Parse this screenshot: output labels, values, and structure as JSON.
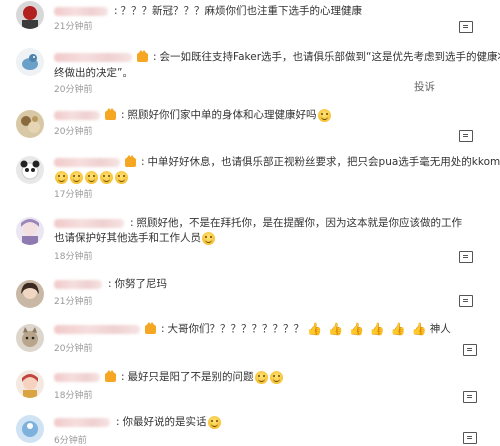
{
  "report_label": "投诉",
  "comments": [
    {
      "name_blur_w": 54,
      "badge": false,
      "text": "？？？新冠？？？麻烦你们也注重下选手的心理健康",
      "time": "21分钟前",
      "avatar": "red"
    },
    {
      "name_blur_w": 78,
      "badge": true,
      "text": "会一如既往支持Faker选手，也请俱乐部做到“这是优先考虑到选手的健康状",
      "text2": "终做出的决定”。",
      "time": "20分钟前",
      "avatar": "bird"
    },
    {
      "name_blur_w": 46,
      "badge": true,
      "text": "照顾好你们家中单的身体和心理健康好吗",
      "time": "20分钟前",
      "avatar": "food"
    },
    {
      "name_blur_w": 66,
      "badge": true,
      "text": "中单好好休息，也请俱乐部正视粉丝要求，把只会pua选手毫无用处的kkoma",
      "text2": "",
      "time": "17分钟前",
      "avatar": "panda"
    },
    {
      "name_blur_w": 70,
      "badge": false,
      "text": "照顾好他，不是在拜托你，是在提醒你，因为这本就是你应该做的工作",
      "text2": "也请保护好其他选手和工作人员",
      "time": "18分钟前",
      "avatar": "anime"
    },
    {
      "name_blur_w": 48,
      "badge": false,
      "text": "你努了尼玛",
      "time": "21分钟前",
      "avatar": "girl"
    },
    {
      "name_blur_w": 86,
      "badge": true,
      "text": "大哥你们？？？？？？？？？",
      "trail": "神人",
      "time": "20分钟前",
      "avatar": "cat"
    },
    {
      "name_blur_w": 46,
      "badge": true,
      "text": "最好只是阳了不是别的问题",
      "time": "18分钟前",
      "avatar": "doll"
    },
    {
      "name_blur_w": 56,
      "badge": false,
      "text": "你最好说的是实话",
      "time": "6分钟前",
      "avatar": "blue"
    }
  ]
}
